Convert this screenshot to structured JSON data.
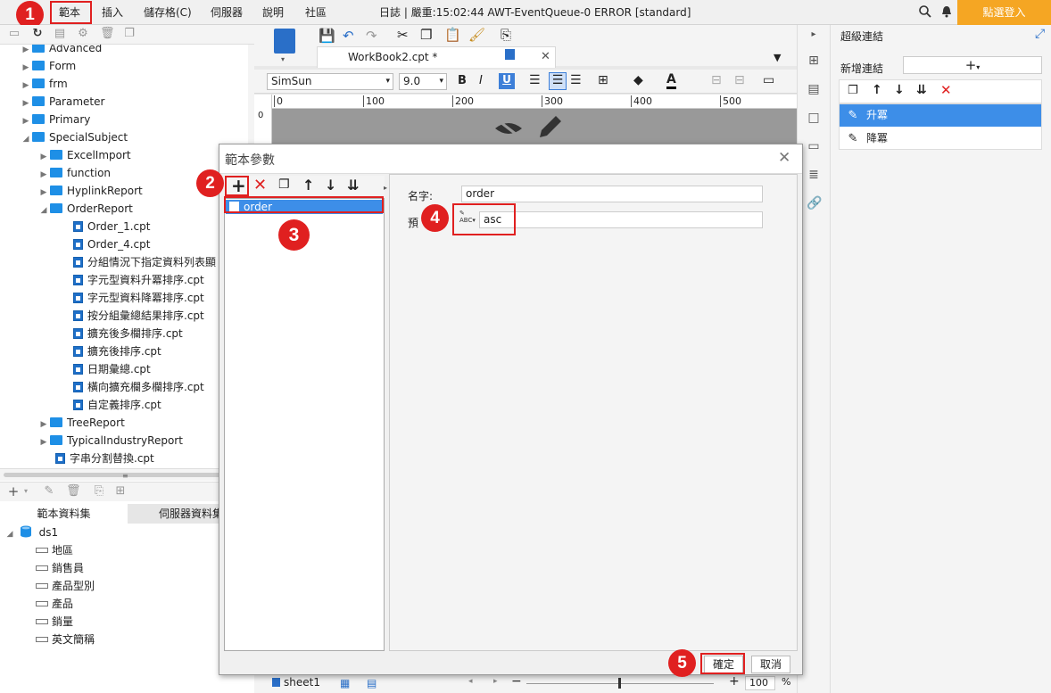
{
  "menu": {
    "template": "範本",
    "insert": "插入",
    "cell": "儲存格(C)",
    "server": "伺服器",
    "help": "說明",
    "community": "社區"
  },
  "log_text": "日誌 | 嚴重:15:02:44 AWT-EventQueue-0 ERROR [standard]",
  "login_label": "點選登入",
  "tree": {
    "items": [
      {
        "label": "Advanced",
        "type": "folder",
        "indent": 0,
        "expanded": false
      },
      {
        "label": "Form",
        "type": "folder",
        "indent": 0,
        "expanded": false
      },
      {
        "label": "frm",
        "type": "folder",
        "indent": 0,
        "expanded": false
      },
      {
        "label": "Parameter",
        "type": "folder",
        "indent": 0,
        "expanded": false
      },
      {
        "label": "Primary",
        "type": "folder",
        "indent": 0,
        "expanded": false
      },
      {
        "label": "SpecialSubject",
        "type": "folder",
        "indent": 0,
        "expanded": true
      },
      {
        "label": "ExcelImport",
        "type": "folder",
        "indent": 1,
        "expanded": false
      },
      {
        "label": "function",
        "type": "folder",
        "indent": 1,
        "expanded": false
      },
      {
        "label": "HyplinkReport",
        "type": "folder",
        "indent": 1,
        "expanded": false
      },
      {
        "label": "OrderReport",
        "type": "folder",
        "indent": 1,
        "expanded": true
      },
      {
        "label": "Order_1.cpt",
        "type": "file",
        "indent": 2
      },
      {
        "label": "Order_4.cpt",
        "type": "file",
        "indent": 2
      },
      {
        "label": "分組情況下指定資料列表顯",
        "type": "file",
        "indent": 2
      },
      {
        "label": "字元型資料升冪排序.cpt",
        "type": "file",
        "indent": 2
      },
      {
        "label": "字元型資料降冪排序.cpt",
        "type": "file",
        "indent": 2
      },
      {
        "label": "按分組彙總結果排序.cpt",
        "type": "file",
        "indent": 2
      },
      {
        "label": "擴充後多欄排序.cpt",
        "type": "file",
        "indent": 2
      },
      {
        "label": "擴充後排序.cpt",
        "type": "file",
        "indent": 2
      },
      {
        "label": "日期彙總.cpt",
        "type": "file",
        "indent": 2
      },
      {
        "label": "橫向擴充欄多欄排序.cpt",
        "type": "file",
        "indent": 2
      },
      {
        "label": "自定義排序.cpt",
        "type": "file",
        "indent": 2
      },
      {
        "label": "TreeReport",
        "type": "folder",
        "indent": 1,
        "expanded": false
      },
      {
        "label": "TypicalIndustryReport",
        "type": "folder",
        "indent": 1,
        "expanded": false
      },
      {
        "label": "字串分割替換.cpt",
        "type": "file",
        "indent": 1
      }
    ]
  },
  "dataset_tabs": {
    "template": "範本資料集",
    "server": "伺服器資料集"
  },
  "dataset": {
    "name": "ds1",
    "fields": [
      "地區",
      "銷售員",
      "產品型別",
      "產品",
      "銷量",
      "英文簡稱"
    ]
  },
  "workbook_tab": "WorkBook2.cpt *",
  "font": {
    "family": "SimSun",
    "size": "9.0"
  },
  "ruler_ticks": [
    "0",
    "100",
    "200",
    "300",
    "400",
    "500"
  ],
  "ruler_vertical_mark": "0",
  "sheet_tab": "sheet1",
  "zoom": {
    "value": "100",
    "unit": "%"
  },
  "right_panel": {
    "title": "超級連結",
    "add_label": "新增連結",
    "links": [
      {
        "label": "升冪",
        "selected": true
      },
      {
        "label": "降冪",
        "selected": false
      }
    ]
  },
  "dialog": {
    "title": "範本參數",
    "params": [
      "order"
    ],
    "name_label": "名字:",
    "name_value": "order",
    "default_label": "預",
    "default_value": "asc",
    "ok_label": "確定",
    "cancel_label": "取消"
  },
  "badges": [
    "1",
    "2",
    "3",
    "4",
    "5"
  ],
  "colors": {
    "accent": "#3399ff",
    "highlight": "#e02020",
    "login": "#f5a623",
    "folder": "#1e8fe6"
  }
}
